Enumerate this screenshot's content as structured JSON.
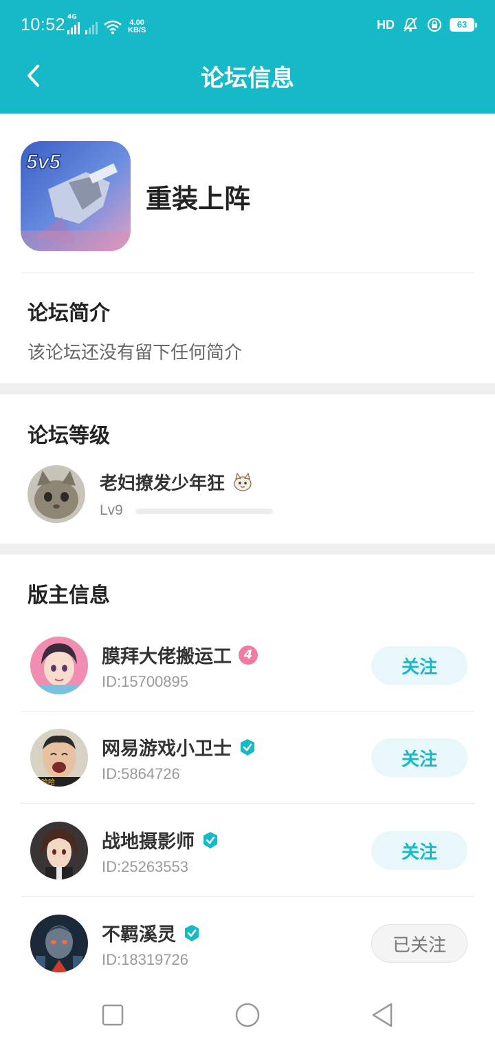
{
  "status_bar": {
    "time": "10:52",
    "network_label": "4G",
    "speed_value": "4.00",
    "speed_unit": "KB/S",
    "hd_label": "HD",
    "battery": "63"
  },
  "header": {
    "title": "论坛信息"
  },
  "forum": {
    "name": "重装上阵",
    "icon_text": "5v5"
  },
  "intro": {
    "title": "论坛简介",
    "text": "该论坛还没有留下任何简介"
  },
  "level": {
    "title": "论坛等级",
    "user_name": "老妇撩发少年狂",
    "level_label": "Lv9",
    "progress": 0.0
  },
  "moderators": {
    "title": "版主信息",
    "items": [
      {
        "name": "膜拜大佬搬运工",
        "badge": "4",
        "id": "ID:15700895",
        "button": "关注"
      },
      {
        "name": "网易游戏小卫士",
        "badge": "verified",
        "id": "ID:5864726",
        "button": "关注"
      },
      {
        "name": "战地摄影师",
        "badge": "verified",
        "id": "ID:25263553",
        "button": "关注"
      },
      {
        "name": "不羁溪灵",
        "badge": "verified",
        "id": "ID:18319726",
        "button": "已关注"
      }
    ]
  },
  "colors": {
    "accent": "#16b9c8",
    "rank_badge": "#f27aa3"
  }
}
